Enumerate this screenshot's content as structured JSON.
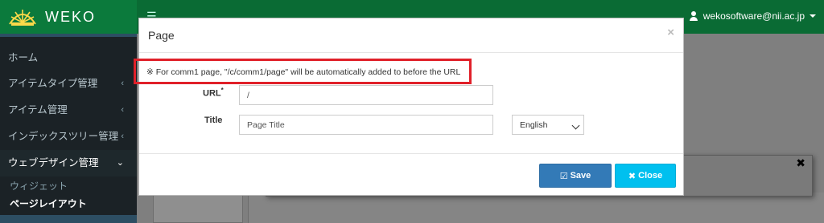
{
  "header": {
    "brand": "WEKO",
    "menu_icon": "hamburger-icon",
    "user_email": "wekosoftware@nii.ac.jp"
  },
  "sidebar": {
    "items": [
      {
        "label": "ホーム"
      },
      {
        "label": "アイテムタイプ管理"
      },
      {
        "label": "アイテム管理"
      },
      {
        "label": "インデックスツリー管理"
      },
      {
        "label": "ウェブデザイン管理"
      }
    ],
    "subitems": [
      {
        "label": "ウィジェット"
      },
      {
        "label": "ページレイアウト"
      }
    ]
  },
  "modal": {
    "title": "Page",
    "close_symbol": "×",
    "notice": "※ For comm1 page, \"/c/comm1/page\" will be automatically added to before the URL",
    "url_label": "URL",
    "url_required": "*",
    "url_value": "/",
    "title_label": "Title",
    "title_placeholder": "Page Title",
    "language": "English",
    "save_label": "Save",
    "close_label": "Close"
  },
  "background": {
    "close_symbol": "✖"
  },
  "colors": {
    "header": "#0a6b34",
    "sidebar": "#1b2226",
    "save": "#337ab7",
    "close": "#00c0ef",
    "highlight": "#e02029"
  }
}
